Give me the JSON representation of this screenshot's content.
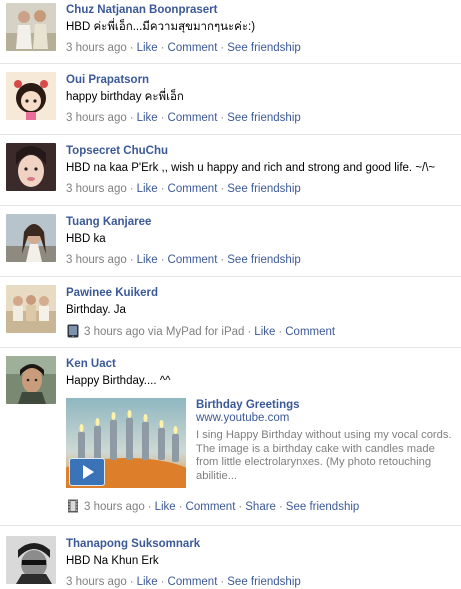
{
  "posts": [
    {
      "name": "Chuz Natjanan Boonprasert",
      "text": "HBD ค่ะพี่เอ็ก...มีความสุขมากๆนะค่ะ:)",
      "time": "3 hours ago",
      "actions": [
        "Like",
        "Comment",
        "See friendship"
      ]
    },
    {
      "name": "Oui Prapatsorn",
      "text": "happy birthday คะพี่เอ็ก",
      "time": "3 hours ago",
      "actions": [
        "Like",
        "Comment",
        "See friendship"
      ]
    },
    {
      "name": "Topsecret ChuChu",
      "text": "HBD na kaa P'Erk ,, wish u happy and rich and strong and good life. ~/\\~",
      "time": "3 hours ago",
      "actions": [
        "Like",
        "Comment",
        "See friendship"
      ]
    },
    {
      "name": "Tuang Kanjaree",
      "text": "HBD ka",
      "time": "3 hours ago",
      "actions": [
        "Like",
        "Comment",
        "See friendship"
      ]
    },
    {
      "name": "Pawinee Kuikerd",
      "text": "Birthday. Ja",
      "time": "3 hours ago via MyPad for iPad",
      "actions": [
        "Like",
        "Comment"
      ]
    },
    {
      "name": "Ken Uact",
      "text": "Happy Birthday.... ^^",
      "time": "3 hours ago",
      "actions": [
        "Like",
        "Comment",
        "Share",
        "See friendship"
      ],
      "link": {
        "title": "Birthday Greetings",
        "url": "www.youtube.com",
        "description": "I sing Happy Birthday without using my vocal cords. The image is a birthday cake with candles made from little electrolarynxes. (My photo retouching abilitie..."
      }
    },
    {
      "name": "Thanapong Suksomnark",
      "text": "HBD Na Khun Erk",
      "time": "3 hours ago",
      "actions": [
        "Like",
        "Comment",
        "See friendship"
      ]
    }
  ],
  "icons": {
    "ipad": "ipad-icon",
    "video": "film-strip-icon",
    "play": "play-button-icon"
  },
  "colors": {
    "link": "#3b5998",
    "meta": "#808080",
    "divider": "#e5e5e5",
    "play_button": "#3b73b9"
  }
}
